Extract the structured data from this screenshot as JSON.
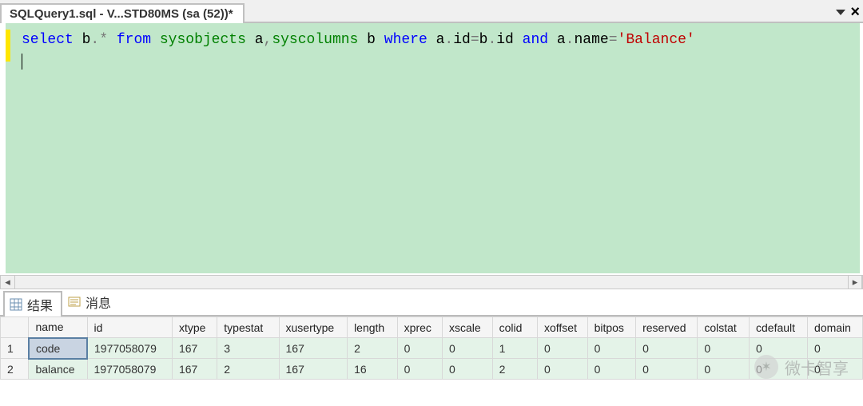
{
  "tab": {
    "title": "SQLQuery1.sql - V...STD80MS (sa (52))*"
  },
  "sql": {
    "tokens": [
      {
        "t": "select",
        "c": "kw"
      },
      {
        "t": " b",
        "c": ""
      },
      {
        "t": ".*",
        "c": "op"
      },
      {
        "t": " ",
        "c": ""
      },
      {
        "t": "from",
        "c": "kw"
      },
      {
        "t": " ",
        "c": ""
      },
      {
        "t": "sysobjects",
        "c": "sys"
      },
      {
        "t": " a",
        "c": ""
      },
      {
        "t": ",",
        "c": "op"
      },
      {
        "t": "syscolumns",
        "c": "sys"
      },
      {
        "t": " b ",
        "c": ""
      },
      {
        "t": "where",
        "c": "kw"
      },
      {
        "t": " a",
        "c": ""
      },
      {
        "t": ".",
        "c": "op"
      },
      {
        "t": "id",
        "c": ""
      },
      {
        "t": "=",
        "c": "op"
      },
      {
        "t": "b",
        "c": ""
      },
      {
        "t": ".",
        "c": "op"
      },
      {
        "t": "id ",
        "c": ""
      },
      {
        "t": "and",
        "c": "kw"
      },
      {
        "t": " a",
        "c": ""
      },
      {
        "t": ".",
        "c": "op"
      },
      {
        "t": "name",
        "c": ""
      },
      {
        "t": "=",
        "c": "op"
      },
      {
        "t": "'Balance'",
        "c": "str"
      }
    ]
  },
  "resultTabs": {
    "results": "结果",
    "messages": "消息"
  },
  "columns": [
    "name",
    "id",
    "xtype",
    "typestat",
    "xusertype",
    "length",
    "xprec",
    "xscale",
    "colid",
    "xoffset",
    "bitpos",
    "reserved",
    "colstat",
    "cdefault",
    "domain"
  ],
  "rows": [
    {
      "n": "1",
      "name": "code",
      "id": "1977058079",
      "xtype": "167",
      "typestat": "3",
      "xusertype": "167",
      "length": "2",
      "xprec": "0",
      "xscale": "0",
      "colid": "1",
      "xoffset": "0",
      "bitpos": "0",
      "reserved": "0",
      "colstat": "0",
      "cdefault": "0",
      "domain": "0"
    },
    {
      "n": "2",
      "name": "balance",
      "id": "1977058079",
      "xtype": "167",
      "typestat": "2",
      "xusertype": "167",
      "length": "16",
      "xprec": "0",
      "xscale": "0",
      "colid": "2",
      "xoffset": "0",
      "bitpos": "0",
      "reserved": "0",
      "colstat": "0",
      "cdefault": "0",
      "domain": "0"
    }
  ],
  "watermark": {
    "text": "微卡智享"
  }
}
